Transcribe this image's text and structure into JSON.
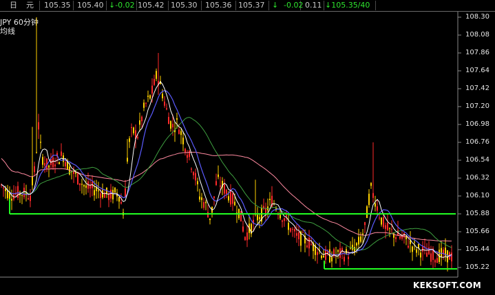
{
  "topbar": {
    "items": [
      {
        "text": "日",
        "color": "#c8c8c8"
      },
      {
        "text": "元",
        "color": "#c8c8c8"
      },
      {
        "text": "105.35",
        "color": "#c8c8c8"
      },
      {
        "text": "105.40",
        "color": "#c8c8c8"
      },
      {
        "text": "↓-0.02",
        "color": "#2ee62e"
      },
      {
        "text": "105.42",
        "color": "#c8c8c8"
      },
      {
        "text": "105.30",
        "color": "#c8c8c8"
      },
      {
        "text": "105.36",
        "color": "#c8c8c8"
      },
      {
        "text": "105.37",
        "color": "#c8c8c8"
      },
      {
        "text": "↓",
        "color": "#2ee62e"
      },
      {
        "text": "-0.02",
        "color": "#2ee62e"
      },
      {
        "text": "0.11",
        "color": "#c8c8c8"
      },
      {
        "text": "↓105.35/40",
        "color": "#2ee62e"
      }
    ]
  },
  "legend": {
    "line1": "JPY   60分钟",
    "line2": "均线"
  },
  "y_axis": {
    "labels": [
      "108.30",
      "108.08",
      "107.86",
      "107.64",
      "107.42",
      "107.20",
      "106.98",
      "106.76",
      "106.54",
      "106.32",
      "106.10",
      "105.88",
      "105.66",
      "105.44",
      "105.22"
    ]
  },
  "watermark": "KEKSOFT.COM",
  "chart_data": {
    "type": "candlestick",
    "timeframe": "60分钟",
    "ylim": [
      105.22,
      108.3
    ],
    "support_lines": [
      105.88,
      105.22
    ],
    "colors": {
      "up": "#ff2a2a",
      "down": "#ffd000",
      "ma_short": "#ffffff",
      "ma_mid": "#5b5bff",
      "ma_long": "#3fa040",
      "ma_longest": "#ff8aa0",
      "support": "#22ff22"
    }
  }
}
